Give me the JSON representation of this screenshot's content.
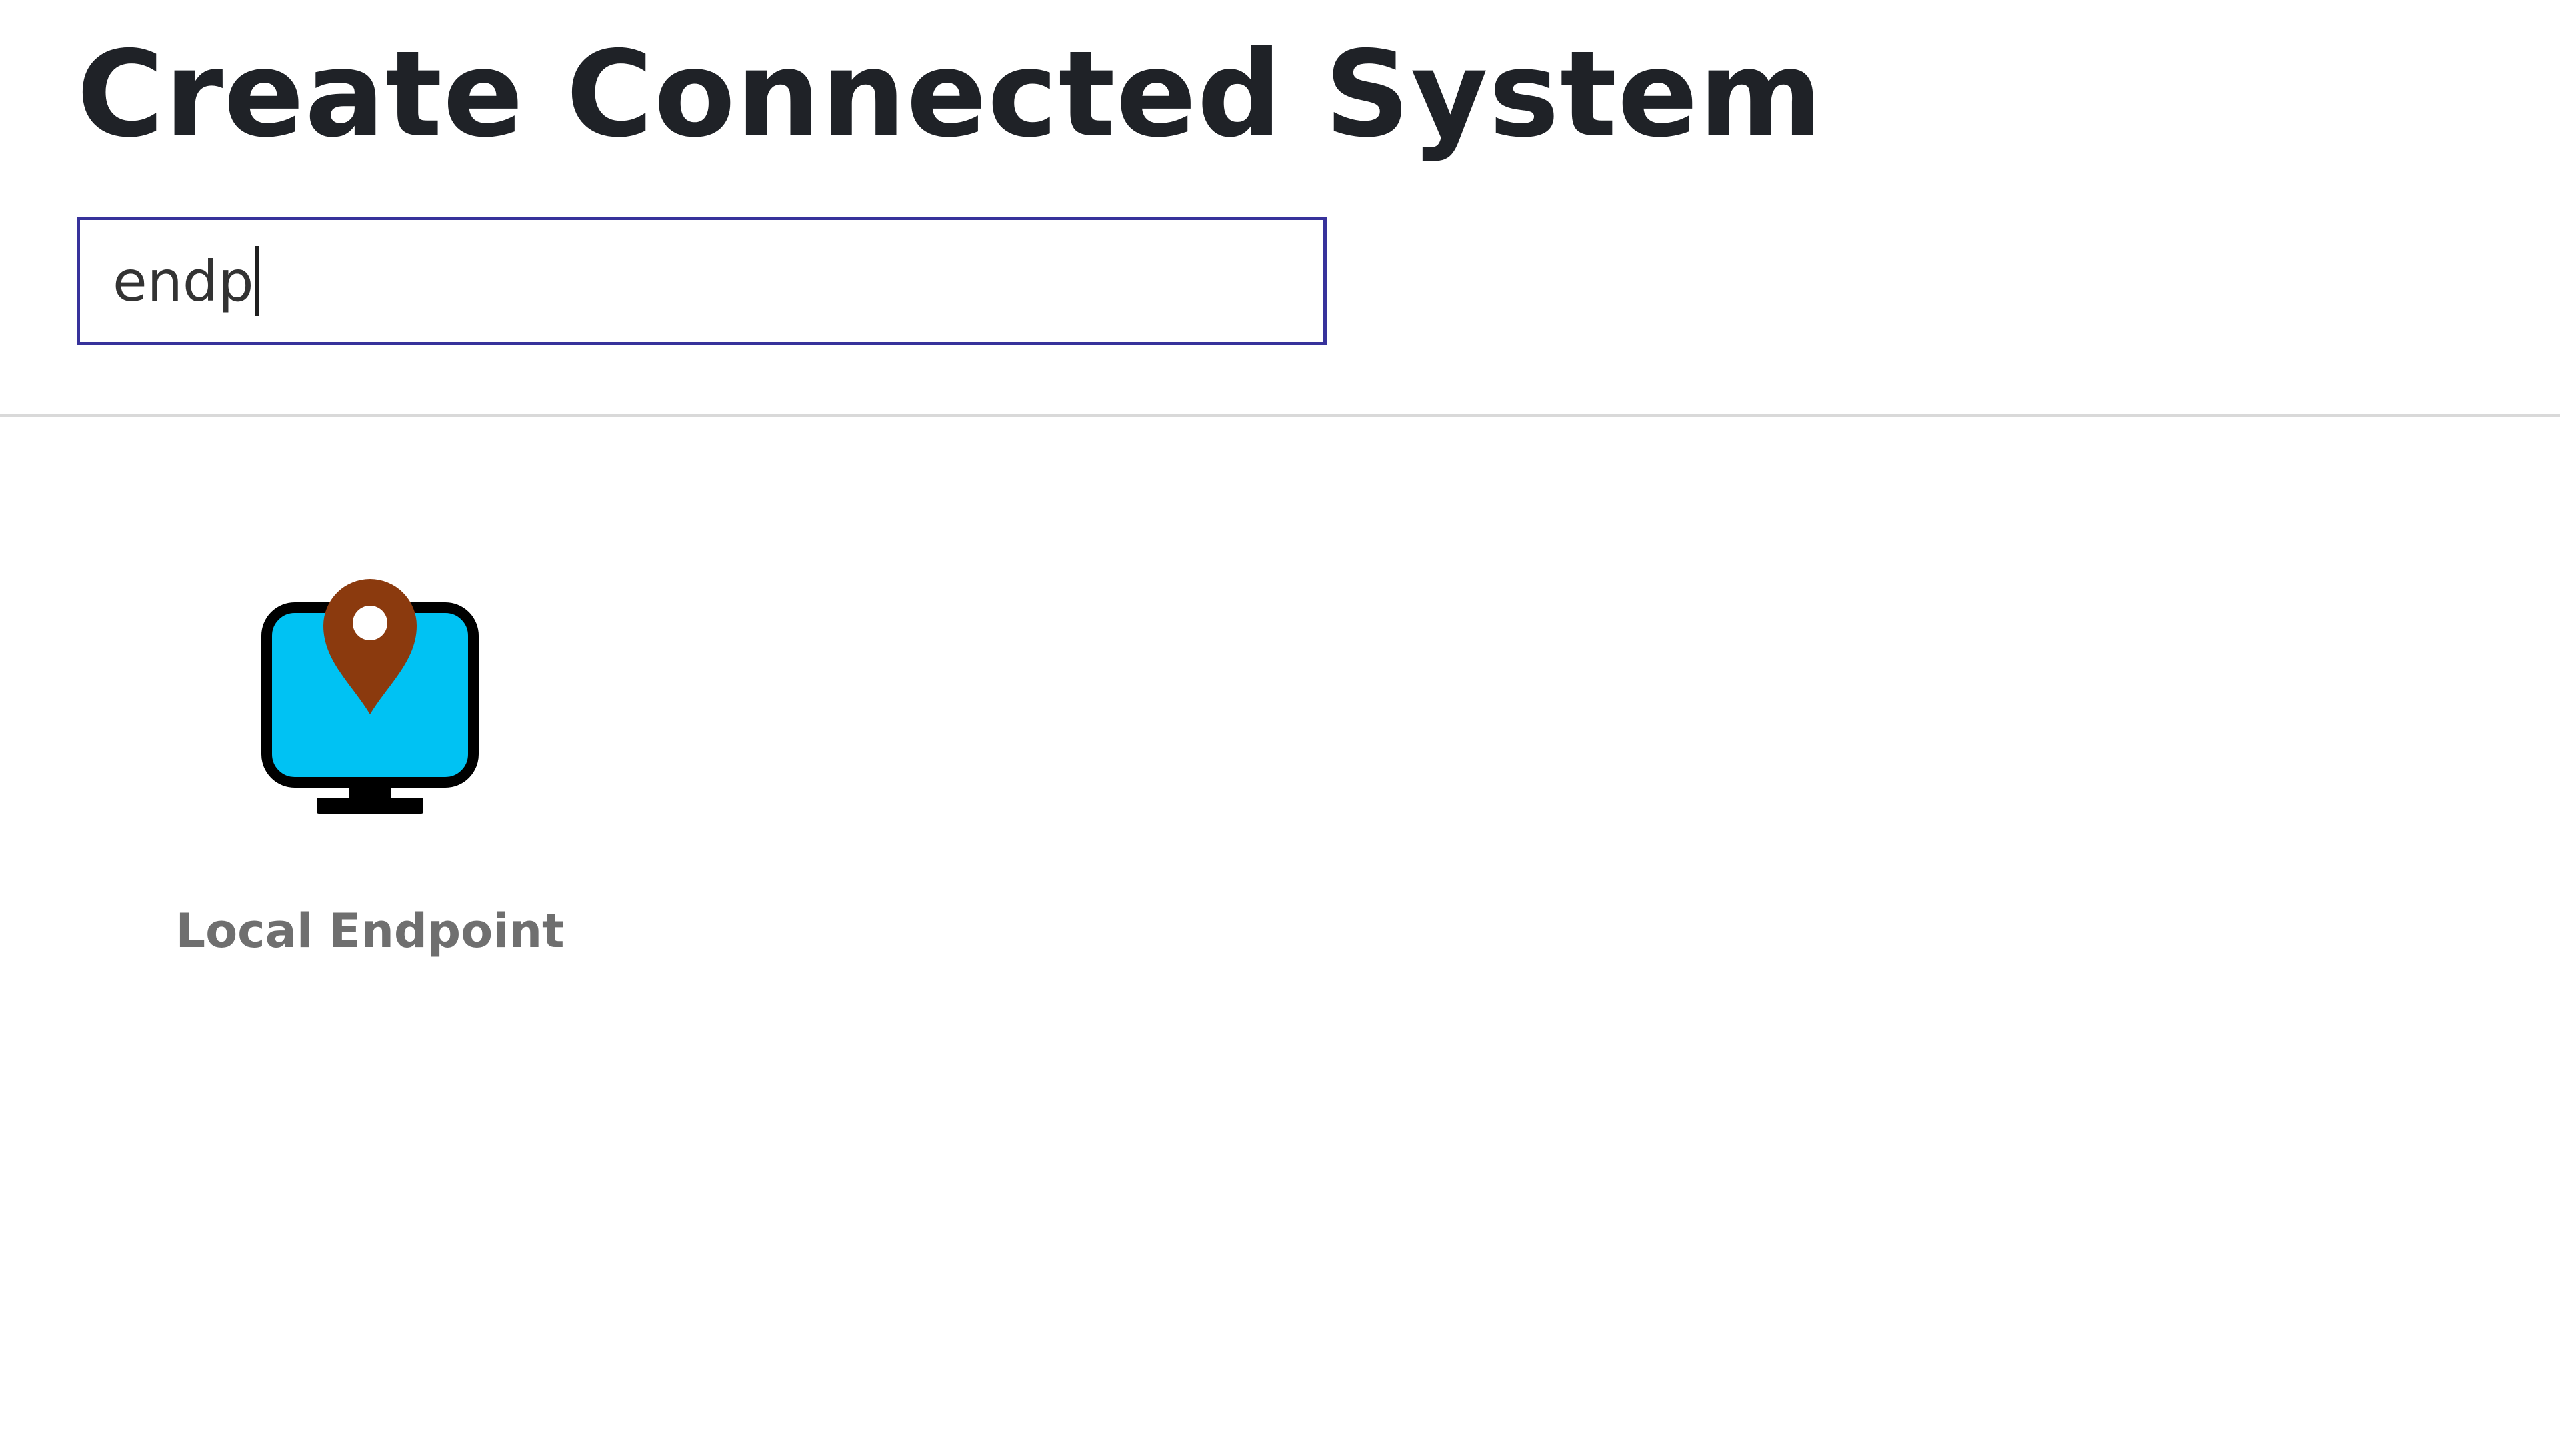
{
  "page": {
    "title": "Create Connected System"
  },
  "search": {
    "value": "endp"
  },
  "results": [
    {
      "label": "Local Endpoint",
      "icon": "local-endpoint-icon",
      "colors": {
        "screen": "#00c2f3",
        "pin": "#8b3a0e",
        "outline": "#000000"
      }
    }
  ],
  "colors": {
    "search_border": "#37329b",
    "divider": "#d9d9d9",
    "title_text": "#1f2227",
    "label_text": "#6f6f6f"
  }
}
